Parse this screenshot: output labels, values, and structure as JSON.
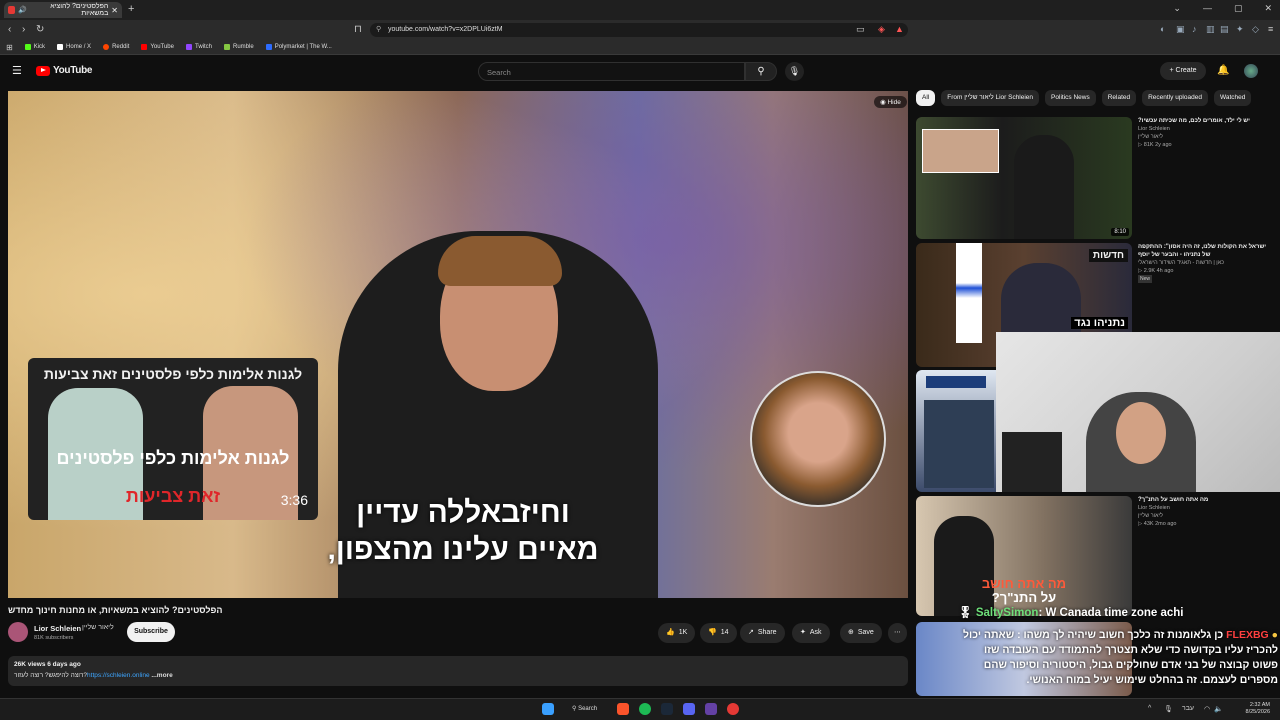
{
  "browser": {
    "tab_title": "הפלסטינים? להוציא במשאיות",
    "url": "youtube.com/watch?v=x2DPLUi6ztM",
    "bookmarks": [
      "Kick",
      "Home / X",
      "Reddit",
      "YouTube",
      "Twitch",
      "Rumble",
      "Polymarket | The W..."
    ]
  },
  "youtube": {
    "logo": "YouTube",
    "search_placeholder": "Search",
    "create_label": "Create",
    "player": {
      "hide_label": "Hide",
      "inset_title": "לגנות אלימות כלפי פלסטינים זאת צביעות",
      "inset_big1": "לגנות אלימות כלפי פלסטינים",
      "inset_big2": "זאת צביעות",
      "inset_duration": "3:36",
      "subtitle_line1": "וחיזבאללה עדיין",
      "subtitle_line2": "מאיים עלינו מהצפון,"
    },
    "video": {
      "title": "הפלסטינים? להוציא במשאיות, או מחנות חינוך מחדש",
      "channel": "Lior Schleien",
      "channel_he": "ליאור שליין",
      "subscribers": "81K subscribers",
      "subscribe_label": "Subscribe",
      "likes": "1K",
      "dislikes": "14",
      "share_label": "Share",
      "ask_label": "Ask",
      "save_label": "Save",
      "views_line": "26K views  6 days ago",
      "desc_prefix": "רוצה להיפגש? רוצה לעזור?",
      "desc_link": "https://schleien.online",
      "more_label": "...more"
    },
    "chips": [
      "All",
      "From ליאור שליין Lior Schleien",
      "Politics News",
      "Related",
      "Recently uploaded",
      "Watched"
    ],
    "related": [
      {
        "title": "יש לי ילד, אומרים לכם, מה שכיתה עכשיו?",
        "channel": "Lior Schleien",
        "channel_he": "ליאור שליין",
        "meta": "81K  2y ago",
        "duration": "8:10"
      },
      {
        "title": "ישראל את הקולות שלנו, זה היה אסון\": ההתקפה של נתניהו - והבער של יוסף",
        "channel": "כאן | חדשות - תאגיד השידור הישראלי",
        "meta": "2.9K  4h ago",
        "badge": "New",
        "thumb_text": "חדשות",
        "thumb_caption": "נתניהו נגד"
      },
      {
        "title": "מה אתה חושב על התנ\"ך?",
        "channel": "Lior Schleien",
        "channel_he": "ליאור שליין",
        "meta": "43K  2mo ago",
        "thumb_text1": "מה אתה חושב",
        "thumb_text2": "על התנ\"ך?"
      }
    ],
    "chat": {
      "msg1_user": "SaltySimon",
      "msg1_text": ": W Canada time zone achi",
      "msg2_user": "FLEXBG",
      "msg2_text": "כן גלאומנות זה כלכך חשוב שיהיה לך משהו : שאתה יכול להכריז עליו בקדושה כדי שלא תצטרך להתמודד עם העובדה שזו פשוט קבוצה של בני אדם שחולקים גבול, היסטוריה וסיפור שהם מספרים לעצמם. זה בהחלט שימוש יעיל במוח האנושי."
    }
  },
  "taskbar": {
    "search_label": "Search",
    "time": "2:32 AM",
    "date": "8/25/2026",
    "lang": "עבר"
  },
  "colors": {
    "accent_red": "#ff0000",
    "link_blue": "#3ea6ff",
    "chat_green": "#6ee07a"
  }
}
